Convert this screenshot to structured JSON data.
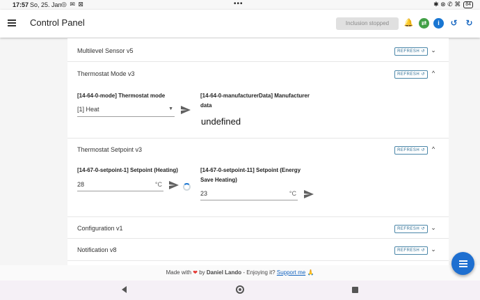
{
  "status_bar": {
    "time": "17:57",
    "date": "So, 25. Jan",
    "left_icons": "◎ ✉ ⊠",
    "center_dots": "•••",
    "right_icons": "✱ ⊗ ✆ ⌘",
    "battery": "84"
  },
  "app_bar": {
    "title": "Control Panel",
    "inclusion_status": "Inclusion stopped",
    "icons": [
      "bell-icon",
      "sync-icon",
      "info-icon",
      "history-icon",
      "refresh-icon"
    ]
  },
  "command_classes": [
    {
      "title": "Multilevel Sensor v5",
      "refresh_label": "REFRESH ↺",
      "expanded": false,
      "chevron": "⌄"
    },
    {
      "title": "Thermostat Mode v3",
      "refresh_label": "REFRESH ↺",
      "expanded": true,
      "chevron": "^"
    },
    {
      "title": "Thermostat Setpoint v3",
      "refresh_label": "REFRESH ↺",
      "expanded": true,
      "chevron": "^"
    },
    {
      "title": "Configuration v1",
      "refresh_label": "REFRESH ↺",
      "expanded": false,
      "chevron": "⌄"
    },
    {
      "title": "Notification v8",
      "refresh_label": "REFRESH ↺",
      "expanded": false,
      "chevron": "⌄"
    }
  ],
  "thermostat_mode": {
    "mode_label": "[14-64-0-mode] Thermostat mode",
    "mode_value": "[1] Heat",
    "manufacturer_label_line1": "[14-64-0-manufacturerData] Manufacturer",
    "manufacturer_label_line2": "data",
    "manufacturer_value": "undefined"
  },
  "thermostat_setpoint": {
    "heating_label": "[14-67-0-setpoint-1] Setpoint (Heating)",
    "heating_value": "28",
    "heating_unit": "°C",
    "energy_label_line1": "[14-67-0-setpoint-11] Setpoint (Energy",
    "energy_label_line2": "Save Heating)",
    "energy_value": "23",
    "energy_unit": "°C"
  },
  "footer": {
    "made_with": "Made with",
    "heart": "❤",
    "by": "by",
    "author": "Daniel Lando",
    "enjoying": "- Enjoying it?",
    "support_link": "Support me",
    "support_emoji": "🙏"
  },
  "colors": {
    "accent": "#1976d2",
    "sync_green": "#43a047",
    "refresh_outline": "#4a86a8",
    "fab": "#1e6fd0"
  }
}
